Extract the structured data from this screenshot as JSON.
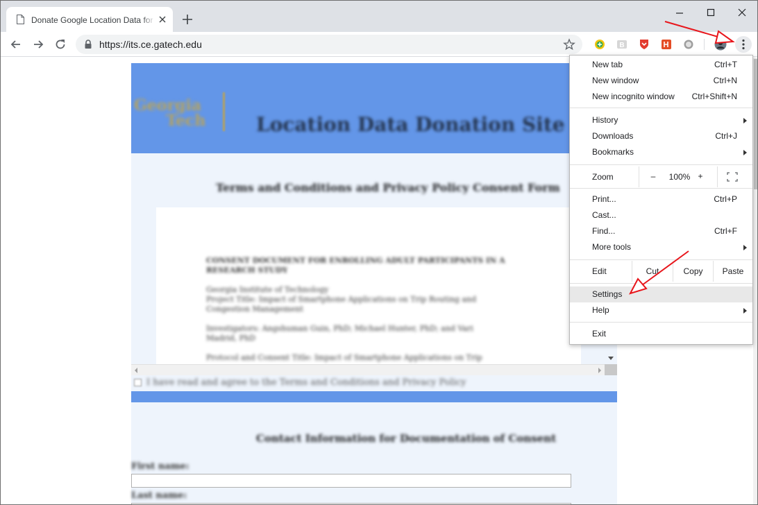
{
  "browser": {
    "tab_title": "Donate Google Location Data for",
    "url": "https://its.ce.gatech.edu"
  },
  "page": {
    "logo_line1": "Georgia",
    "logo_line2": "Tech",
    "site_title": "Location Data Donation Site",
    "consent_heading": "Terms and Conditions and Privacy Policy Consent Form",
    "doc_lines": [
      "CONSENT DOCUMENT FOR ENROLLING ADULT PARTICIPANTS IN A",
      "RESEARCH STUDY",
      "Georgia Institute of Technology",
      "Project Title: Impact of Smartphone Applications on Trip Routing and",
      "Congestion Management",
      "Investigators: Angshuman Guin, PhD; Michael Hunter, PhD; and Vari",
      "Madrid, PhD",
      "Protocol and Consent Title: Impact of Smartphone Applications on Trip"
    ],
    "agree_text": "I have read and agree to the Terms and Conditions and Privacy Policy",
    "contact_heading": "Contact Information for Documentation of Consent",
    "first_name_label": "First name:",
    "last_name_label": "Last name:"
  },
  "menu": {
    "new_tab": "New tab",
    "new_tab_sc": "Ctrl+T",
    "new_window": "New window",
    "new_window_sc": "Ctrl+N",
    "incognito": "New incognito window",
    "incognito_sc": "Ctrl+Shift+N",
    "history": "History",
    "downloads": "Downloads",
    "downloads_sc": "Ctrl+J",
    "bookmarks": "Bookmarks",
    "zoom": "Zoom",
    "zoom_minus": "–",
    "zoom_value": "100%",
    "zoom_plus": "+",
    "print": "Print...",
    "print_sc": "Ctrl+P",
    "cast": "Cast...",
    "find": "Find...",
    "find_sc": "Ctrl+F",
    "more_tools": "More tools",
    "edit": "Edit",
    "cut": "Cut",
    "copy": "Copy",
    "paste": "Paste",
    "settings": "Settings",
    "help": "Help",
    "exit": "Exit"
  },
  "colors": {
    "annotation_arrow": "#e8151b",
    "site_header": "#6396e8",
    "logo_gold": "#b7a35b"
  }
}
